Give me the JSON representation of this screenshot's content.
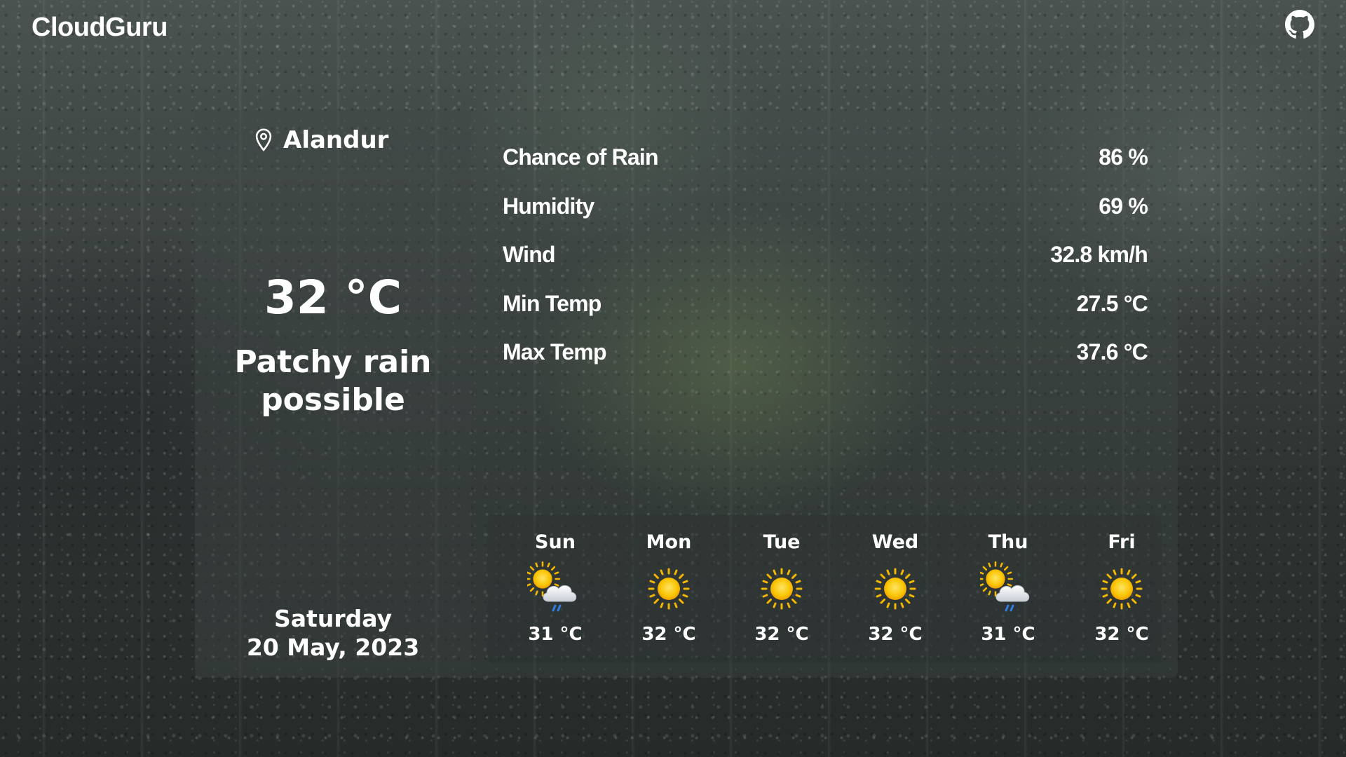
{
  "app": {
    "title": "CloudGuru"
  },
  "header": {
    "github_icon": "github-icon"
  },
  "current": {
    "location": "Alandur",
    "temperature": "32 °C",
    "condition": "Patchy rain possible",
    "weekday": "Saturday",
    "date": "20 May, 2023"
  },
  "stats": [
    {
      "label": "Chance of Rain",
      "value": "86 %"
    },
    {
      "label": "Humidity",
      "value": "69 %"
    },
    {
      "label": "Wind",
      "value": "32.8 km/h"
    },
    {
      "label": "Min Temp",
      "value": "27.5 °C"
    },
    {
      "label": "Max Temp",
      "value": "37.6 °C"
    }
  ],
  "forecast": [
    {
      "day": "Sun",
      "temp": "31 °C",
      "icon": "sun-cloud-rain-icon"
    },
    {
      "day": "Mon",
      "temp": "32 °C",
      "icon": "sun-icon"
    },
    {
      "day": "Tue",
      "temp": "32 °C",
      "icon": "sun-icon"
    },
    {
      "day": "Wed",
      "temp": "32 °C",
      "icon": "sun-icon"
    },
    {
      "day": "Thu",
      "temp": "31 °C",
      "icon": "sun-cloud-rain-icon"
    },
    {
      "day": "Fri",
      "temp": "32 °C",
      "icon": "sun-icon"
    }
  ],
  "colors": {
    "text": "#ffffff",
    "sun": "#f7b500",
    "cloud": "#e8eaee",
    "rain": "#2f7de1"
  }
}
